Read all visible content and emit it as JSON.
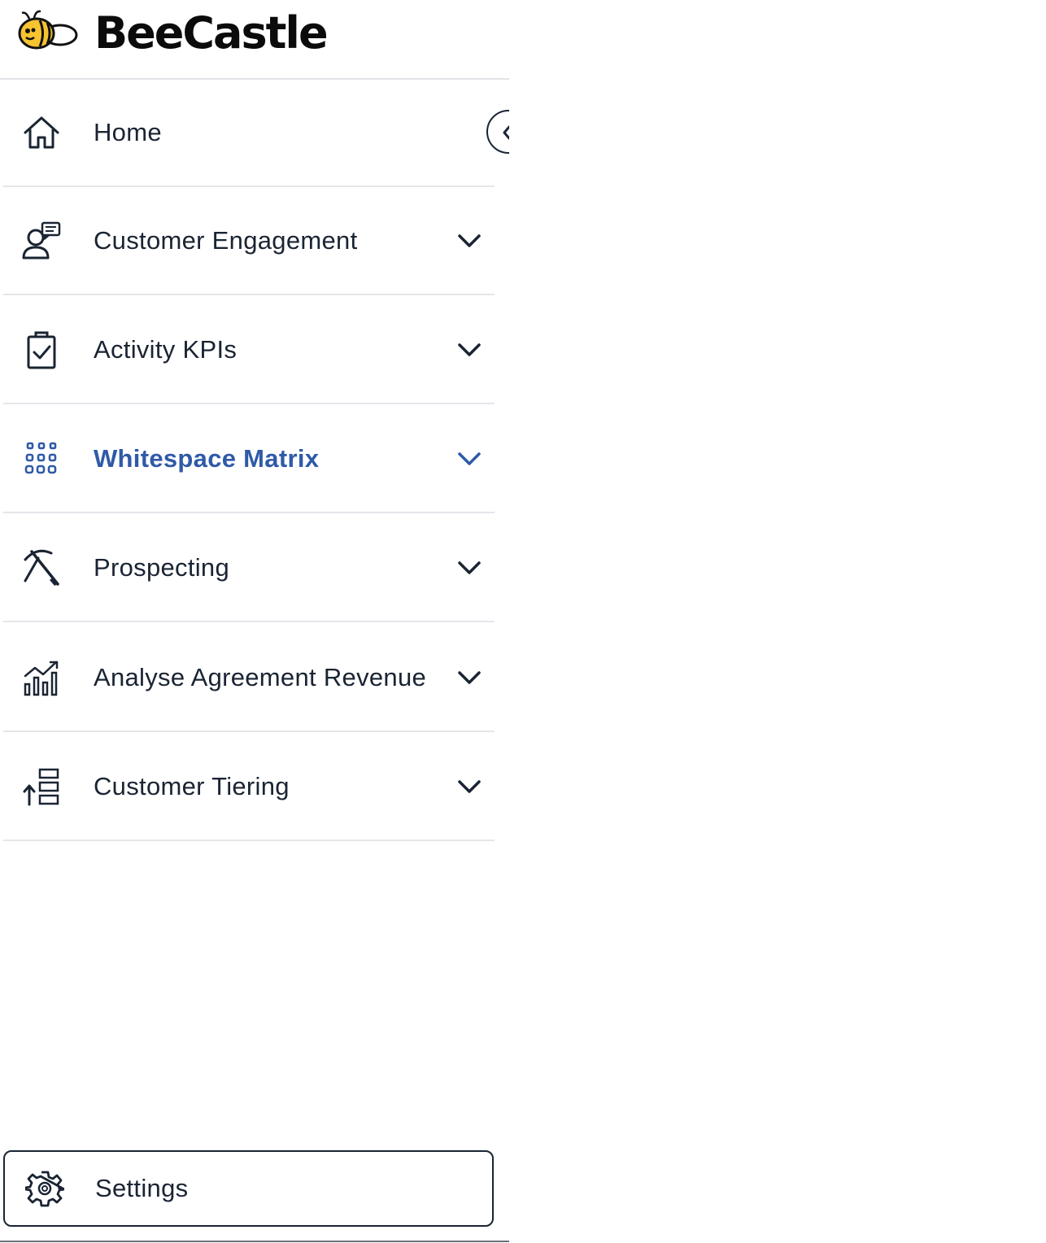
{
  "brand": {
    "name": "BeeCastle",
    "logo_icon": "bee-logo-icon"
  },
  "nav": {
    "items": [
      {
        "label": "Home",
        "icon": "home-icon",
        "expandable": false,
        "active": false
      },
      {
        "label": "Customer Engagement",
        "icon": "customer-chat-icon",
        "expandable": true,
        "active": false
      },
      {
        "label": "Activity KPIs",
        "icon": "clipboard-check-icon",
        "expandable": true,
        "active": false
      },
      {
        "label": "Whitespace Matrix",
        "icon": "dot-grid-icon",
        "expandable": true,
        "active": true
      },
      {
        "label": "Prospecting",
        "icon": "pickaxe-icon",
        "expandable": true,
        "active": false
      },
      {
        "label": "Analyse Agreement Revenue",
        "icon": "bar-chart-trend-icon",
        "expandable": true,
        "active": false
      },
      {
        "label": "Customer Tiering",
        "icon": "tiering-icon",
        "expandable": true,
        "active": false
      }
    ]
  },
  "settings": {
    "label": "Settings",
    "icon": "gear-icon"
  },
  "colors": {
    "text": "#1a2433",
    "active": "#2f5aa8",
    "divider": "#e4e6ea",
    "bee_yellow": "#f6c431"
  }
}
